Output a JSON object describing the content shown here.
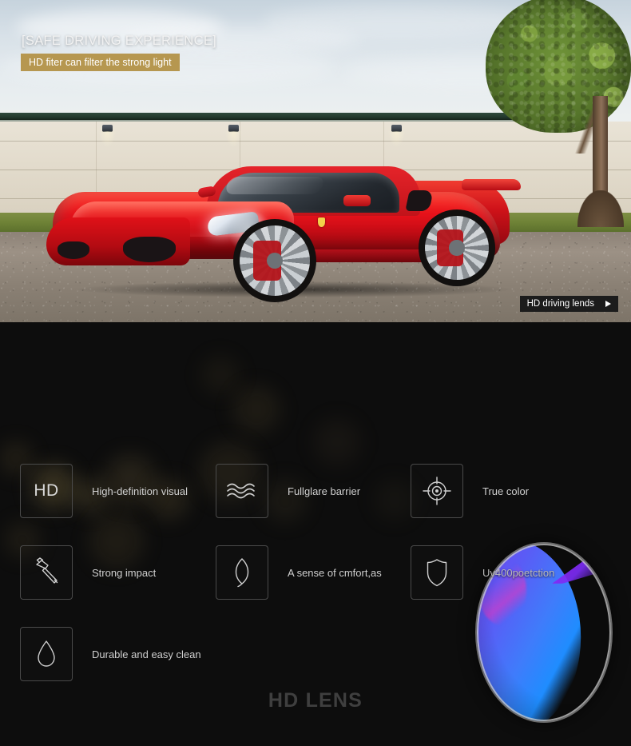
{
  "hero": {
    "kicker": "[SAFE DRIVING EXPERIENCE]",
    "banner": "HD fiter can filter the strong light",
    "banner_color": "#b69750",
    "tag": "HD driving lends",
    "tag_icon": "play-triangle-icon",
    "scene": "red-sports-car-front-of-wall-with-tree"
  },
  "section": {
    "title": "HD LENS",
    "title_color": "#3f3f3f",
    "background_color": "#0d0d0d"
  },
  "features": [
    {
      "icon": "hd-text-icon",
      "icon_text": "HD",
      "label": "High-definition visual"
    },
    {
      "icon": "waves-icon",
      "icon_text": "",
      "label": "Fullglare barrier"
    },
    {
      "icon": "crosshair-icon",
      "icon_text": "",
      "label": "True color"
    },
    {
      "icon": "hammer-icon",
      "icon_text": "",
      "label": "Strong impact"
    },
    {
      "icon": "leaf-icon",
      "icon_text": "",
      "label": "A sense  of cmfort,as"
    },
    {
      "icon": "shield-icon",
      "icon_text": "",
      "label": "Uv400poetction"
    },
    {
      "icon": "water-drop-icon",
      "icon_text": "",
      "label": "Durable and easy clean"
    }
  ],
  "product": {
    "name": "optical-lens",
    "gradient_from": "#7b3bf0",
    "gradient_to": "#1f8dff",
    "accent": "#a21cf0"
  }
}
